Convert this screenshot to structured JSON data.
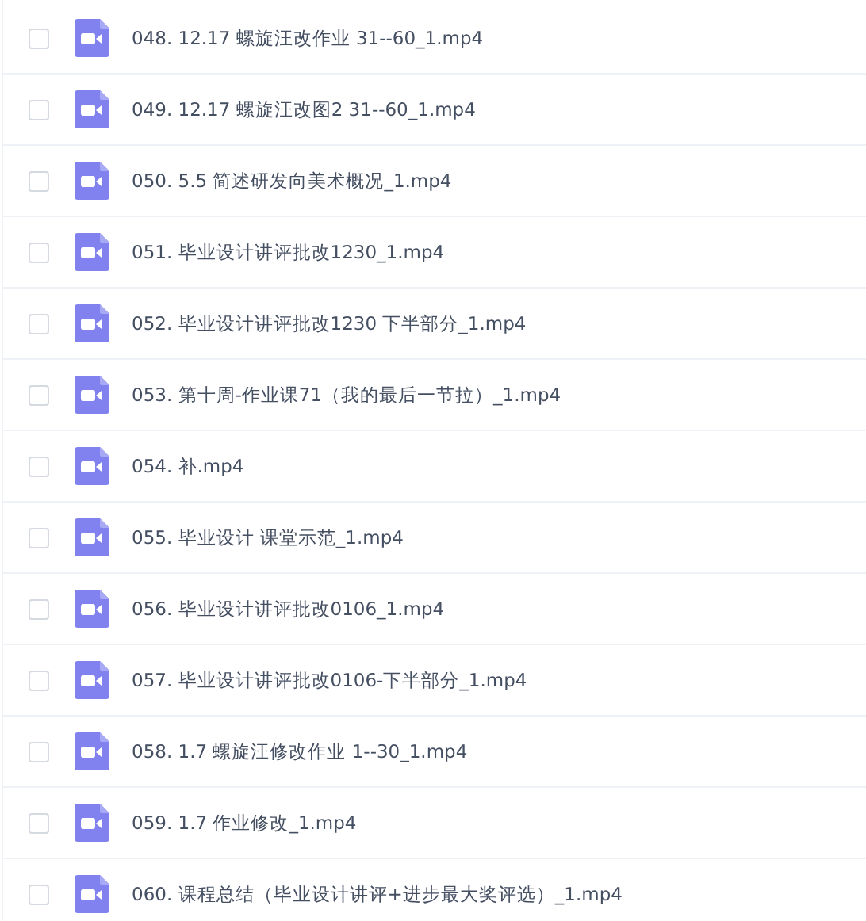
{
  "files": [
    {
      "name": "048. 12.17 螺旋汪改作业 31--60_1.mp4",
      "checked": false
    },
    {
      "name": "049. 12.17 螺旋汪改图2 31--60_1.mp4",
      "checked": false
    },
    {
      "name": "050. 5.5 简述研发向美术概况_1.mp4",
      "checked": false
    },
    {
      "name": "051. 毕业设计讲评批改1230_1.mp4",
      "checked": false
    },
    {
      "name": "052. 毕业设计讲评批改1230 下半部分_1.mp4",
      "checked": false
    },
    {
      "name": "053. 第十周-作业课71（我的最后一节拉）_1.mp4",
      "checked": false
    },
    {
      "name": "054. 补.mp4",
      "checked": false
    },
    {
      "name": "055. 毕业设计 课堂示范_1.mp4",
      "checked": false
    },
    {
      "name": "056. 毕业设计讲评批改0106_1.mp4",
      "checked": false
    },
    {
      "name": "057. 毕业设计讲评批改0106-下半部分_1.mp4",
      "checked": false
    },
    {
      "name": "058. 1.7 螺旋汪修改作业 1--30_1.mp4",
      "checked": false
    },
    {
      "name": "059. 1.7 作业修改_1.mp4",
      "checked": false
    },
    {
      "name": "060. 课程总结（毕业设计讲评+进步最大奖评选）_1.mp4",
      "checked": false
    }
  ]
}
